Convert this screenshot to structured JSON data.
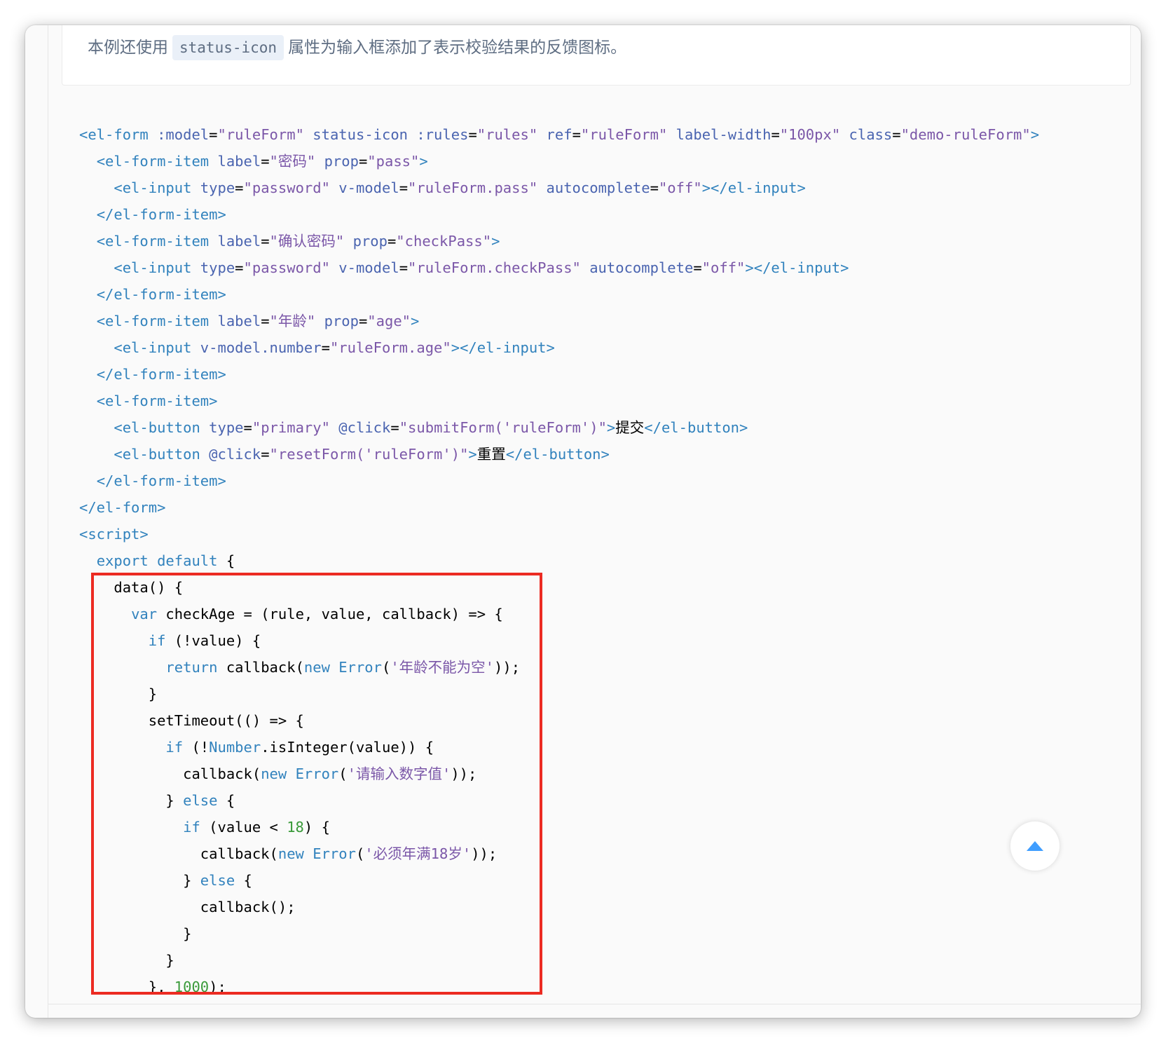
{
  "description": {
    "before": "本例还使用",
    "code": "status-icon",
    "after": "属性为输入框添加了表示校验结果的反馈图标。"
  },
  "code_lines": [
    [
      [
        "t",
        "<el-form "
      ],
      [
        "a",
        ":model"
      ],
      [
        "p",
        "="
      ],
      [
        "v",
        "\"ruleForm\""
      ],
      [
        "p",
        " "
      ],
      [
        "a",
        "status-icon"
      ],
      [
        "p",
        " "
      ],
      [
        "a",
        ":rules"
      ],
      [
        "p",
        "="
      ],
      [
        "v",
        "\"rules\""
      ],
      [
        "p",
        " "
      ],
      [
        "a",
        "ref"
      ],
      [
        "p",
        "="
      ],
      [
        "v",
        "\"ruleForm\""
      ],
      [
        "p",
        " "
      ],
      [
        "a",
        "label-width"
      ],
      [
        "p",
        "="
      ],
      [
        "v",
        "\"100px\""
      ],
      [
        "p",
        " "
      ],
      [
        "a",
        "class"
      ],
      [
        "p",
        "="
      ],
      [
        "v",
        "\"demo-ruleForm\""
      ],
      [
        "t",
        ">"
      ]
    ],
    [
      [
        "p",
        "  "
      ],
      [
        "t",
        "<el-form-item "
      ],
      [
        "a",
        "label"
      ],
      [
        "p",
        "="
      ],
      [
        "v",
        "\"密码\""
      ],
      [
        "p",
        " "
      ],
      [
        "a",
        "prop"
      ],
      [
        "p",
        "="
      ],
      [
        "v",
        "\"pass\""
      ],
      [
        "t",
        ">"
      ]
    ],
    [
      [
        "p",
        "    "
      ],
      [
        "t",
        "<el-input "
      ],
      [
        "a",
        "type"
      ],
      [
        "p",
        "="
      ],
      [
        "v",
        "\"password\""
      ],
      [
        "p",
        " "
      ],
      [
        "a",
        "v-model"
      ],
      [
        "p",
        "="
      ],
      [
        "v",
        "\"ruleForm.pass\""
      ],
      [
        "p",
        " "
      ],
      [
        "a",
        "autocomplete"
      ],
      [
        "p",
        "="
      ],
      [
        "v",
        "\"off\""
      ],
      [
        "t",
        "></el-input>"
      ]
    ],
    [
      [
        "p",
        "  "
      ],
      [
        "t",
        "</el-form-item>"
      ]
    ],
    [
      [
        "p",
        "  "
      ],
      [
        "t",
        "<el-form-item "
      ],
      [
        "a",
        "label"
      ],
      [
        "p",
        "="
      ],
      [
        "v",
        "\"确认密码\""
      ],
      [
        "p",
        " "
      ],
      [
        "a",
        "prop"
      ],
      [
        "p",
        "="
      ],
      [
        "v",
        "\"checkPass\""
      ],
      [
        "t",
        ">"
      ]
    ],
    [
      [
        "p",
        "    "
      ],
      [
        "t",
        "<el-input "
      ],
      [
        "a",
        "type"
      ],
      [
        "p",
        "="
      ],
      [
        "v",
        "\"password\""
      ],
      [
        "p",
        " "
      ],
      [
        "a",
        "v-model"
      ],
      [
        "p",
        "="
      ],
      [
        "v",
        "\"ruleForm.checkPass\""
      ],
      [
        "p",
        " "
      ],
      [
        "a",
        "autocomplete"
      ],
      [
        "p",
        "="
      ],
      [
        "v",
        "\"off\""
      ],
      [
        "t",
        "></el-input>"
      ]
    ],
    [
      [
        "p",
        "  "
      ],
      [
        "t",
        "</el-form-item>"
      ]
    ],
    [
      [
        "p",
        "  "
      ],
      [
        "t",
        "<el-form-item "
      ],
      [
        "a",
        "label"
      ],
      [
        "p",
        "="
      ],
      [
        "v",
        "\"年龄\""
      ],
      [
        "p",
        " "
      ],
      [
        "a",
        "prop"
      ],
      [
        "p",
        "="
      ],
      [
        "v",
        "\"age\""
      ],
      [
        "t",
        ">"
      ]
    ],
    [
      [
        "p",
        "    "
      ],
      [
        "t",
        "<el-input "
      ],
      [
        "a",
        "v-model.number"
      ],
      [
        "p",
        "="
      ],
      [
        "v",
        "\"ruleForm.age\""
      ],
      [
        "t",
        "></el-input>"
      ]
    ],
    [
      [
        "p",
        "  "
      ],
      [
        "t",
        "</el-form-item>"
      ]
    ],
    [
      [
        "p",
        "  "
      ],
      [
        "t",
        "<el-form-item>"
      ]
    ],
    [
      [
        "p",
        "    "
      ],
      [
        "t",
        "<el-button "
      ],
      [
        "a",
        "type"
      ],
      [
        "p",
        "="
      ],
      [
        "v",
        "\"primary\""
      ],
      [
        "p",
        " "
      ],
      [
        "a",
        "@click"
      ],
      [
        "p",
        "="
      ],
      [
        "v",
        "\"submitForm('ruleForm')\""
      ],
      [
        "t",
        ">"
      ],
      [
        "p",
        "提交"
      ],
      [
        "t",
        "</el-button>"
      ]
    ],
    [
      [
        "p",
        "    "
      ],
      [
        "t",
        "<el-button "
      ],
      [
        "a",
        "@click"
      ],
      [
        "p",
        "="
      ],
      [
        "v",
        "\"resetForm('ruleForm')\""
      ],
      [
        "t",
        ">"
      ],
      [
        "p",
        "重置"
      ],
      [
        "t",
        "</el-button>"
      ]
    ],
    [
      [
        "p",
        "  "
      ],
      [
        "t",
        "</el-form-item>"
      ]
    ],
    [
      [
        "t",
        "</el-form>"
      ]
    ],
    [
      [
        "t",
        "<script>"
      ]
    ],
    [
      [
        "p",
        "  "
      ],
      [
        "k",
        "export"
      ],
      [
        "p",
        " "
      ],
      [
        "k",
        "default"
      ],
      [
        "p",
        " {"
      ]
    ],
    [
      [
        "p",
        "    data() {"
      ]
    ],
    [
      [
        "p",
        "      "
      ],
      [
        "k",
        "var"
      ],
      [
        "p",
        " checkAge = (rule, value, callback) => {"
      ]
    ],
    [
      [
        "p",
        "        "
      ],
      [
        "k",
        "if"
      ],
      [
        "p",
        " (!value) {"
      ]
    ],
    [
      [
        "p",
        "          "
      ],
      [
        "k",
        "return"
      ],
      [
        "p",
        " callback("
      ],
      [
        "k",
        "new"
      ],
      [
        "p",
        " "
      ],
      [
        "k",
        "Error"
      ],
      [
        "p",
        "("
      ],
      [
        "s",
        "'年龄不能为空'"
      ],
      [
        "p",
        "));"
      ]
    ],
    [
      [
        "p",
        "        }"
      ]
    ],
    [
      [
        "p",
        "        setTimeout(() => {"
      ]
    ],
    [
      [
        "p",
        "          "
      ],
      [
        "k",
        "if"
      ],
      [
        "p",
        " (!"
      ],
      [
        "k",
        "Number"
      ],
      [
        "p",
        ".isInteger(value)) {"
      ]
    ],
    [
      [
        "p",
        "            callback("
      ],
      [
        "k",
        "new"
      ],
      [
        "p",
        " "
      ],
      [
        "k",
        "Error"
      ],
      [
        "p",
        "("
      ],
      [
        "s",
        "'请输入数字值'"
      ],
      [
        "p",
        "));"
      ]
    ],
    [
      [
        "p",
        "          } "
      ],
      [
        "k",
        "else"
      ],
      [
        "p",
        " {"
      ]
    ],
    [
      [
        "p",
        "            "
      ],
      [
        "k",
        "if"
      ],
      [
        "p",
        " (value < "
      ],
      [
        "n",
        "18"
      ],
      [
        "p",
        ") {"
      ]
    ],
    [
      [
        "p",
        "              callback("
      ],
      [
        "k",
        "new"
      ],
      [
        "p",
        " "
      ],
      [
        "k",
        "Error"
      ],
      [
        "p",
        "("
      ],
      [
        "s",
        "'必须年满18岁'"
      ],
      [
        "p",
        "));"
      ]
    ],
    [
      [
        "p",
        "            } "
      ],
      [
        "k",
        "else"
      ],
      [
        "p",
        " {"
      ]
    ],
    [
      [
        "p",
        "              callback();"
      ]
    ],
    [
      [
        "p",
        "            }"
      ]
    ],
    [
      [
        "p",
        "          }"
      ]
    ],
    [
      [
        "p",
        "        }, "
      ],
      [
        "n",
        "1000"
      ],
      [
        "p",
        ");"
      ]
    ]
  ],
  "colors": {
    "tag": "#3182bd",
    "attribute": "#4a64b0",
    "string": "#7b57a8",
    "number": "#3a9a3a",
    "highlight_border": "#ec2b22",
    "back_to_top_arrow": "#409eff"
  },
  "icons": {
    "back_to_top": "caret-up-icon"
  }
}
